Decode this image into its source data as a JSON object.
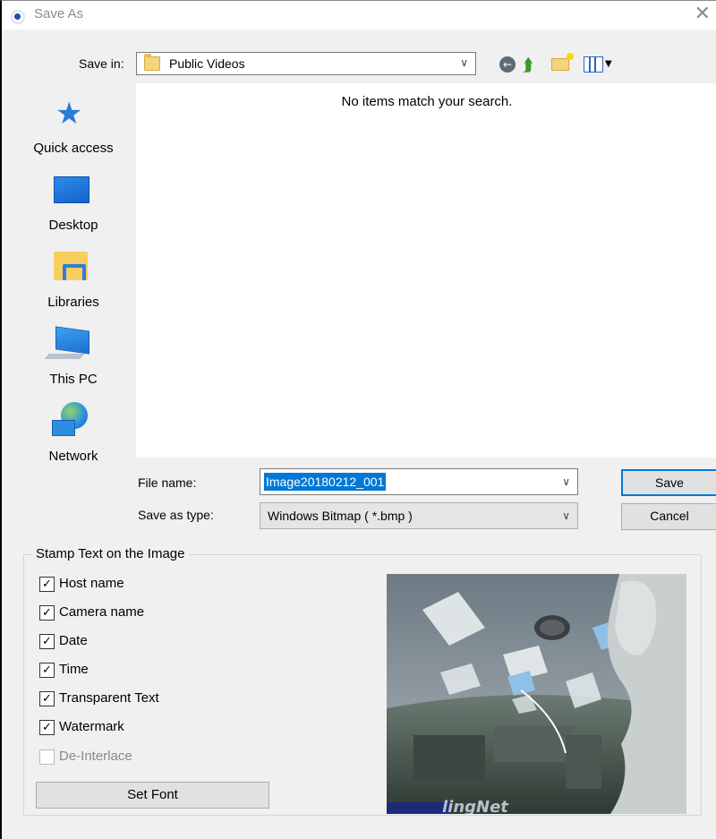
{
  "window": {
    "title": "Save As"
  },
  "toolbar": {
    "save_in_label": "Save in:",
    "location": "Public Videos"
  },
  "places": [
    {
      "label": "Quick access",
      "icon": "star-icon"
    },
    {
      "label": "Desktop",
      "icon": "desktop-icon"
    },
    {
      "label": "Libraries",
      "icon": "libraries-icon"
    },
    {
      "label": "This PC",
      "icon": "computer-icon"
    },
    {
      "label": "Network",
      "icon": "network-icon"
    }
  ],
  "file_list": {
    "empty_message": "No items match your search."
  },
  "file_name": {
    "label": "File name:",
    "value": "Image20180212_001"
  },
  "file_type": {
    "label": "Save as type:",
    "value": "Windows Bitmap ( *.bmp )"
  },
  "buttons": {
    "save": "Save",
    "cancel": "Cancel",
    "set_font": "Set Font"
  },
  "stamp": {
    "title": "Stamp Text on the Image",
    "options": [
      {
        "label": "Host name",
        "checked": true,
        "enabled": true
      },
      {
        "label": "Camera name",
        "checked": true,
        "enabled": true
      },
      {
        "label": "Date",
        "checked": true,
        "enabled": true
      },
      {
        "label": "Time",
        "checked": true,
        "enabled": true
      },
      {
        "label": "Transparent Text",
        "checked": true,
        "enabled": true
      },
      {
        "label": "Watermark",
        "checked": true,
        "enabled": true
      },
      {
        "label": "De-Interlace",
        "checked": false,
        "enabled": false
      }
    ],
    "preview_watermark": "lingNet"
  }
}
